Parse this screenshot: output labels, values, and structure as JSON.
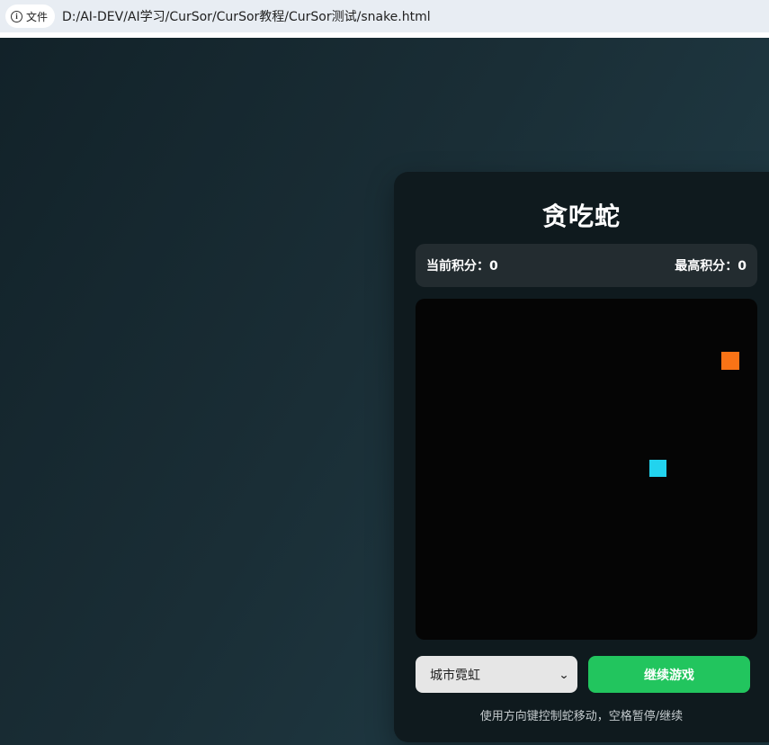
{
  "browser": {
    "site_chip_label": "文件",
    "url": "D:/AI-DEV/AI学习/CurSor/CurSor教程/CurSor测试/snake.html"
  },
  "game": {
    "title": "贪吃蛇",
    "current_score_label": "当前积分：",
    "current_score": "0",
    "high_score_label": "最高积分：",
    "high_score": "0",
    "mode_select_value": "城市霓虹",
    "continue_button": "继续游戏",
    "hint": "使用方向键控制蛇移动，空格暂停/继续"
  },
  "colors": {
    "food": "#f97316",
    "snake": "#22d3ee",
    "button": "#22c55e"
  },
  "icons": {
    "site_info": "info-icon",
    "select_arrow": "chevron-down-icon"
  }
}
